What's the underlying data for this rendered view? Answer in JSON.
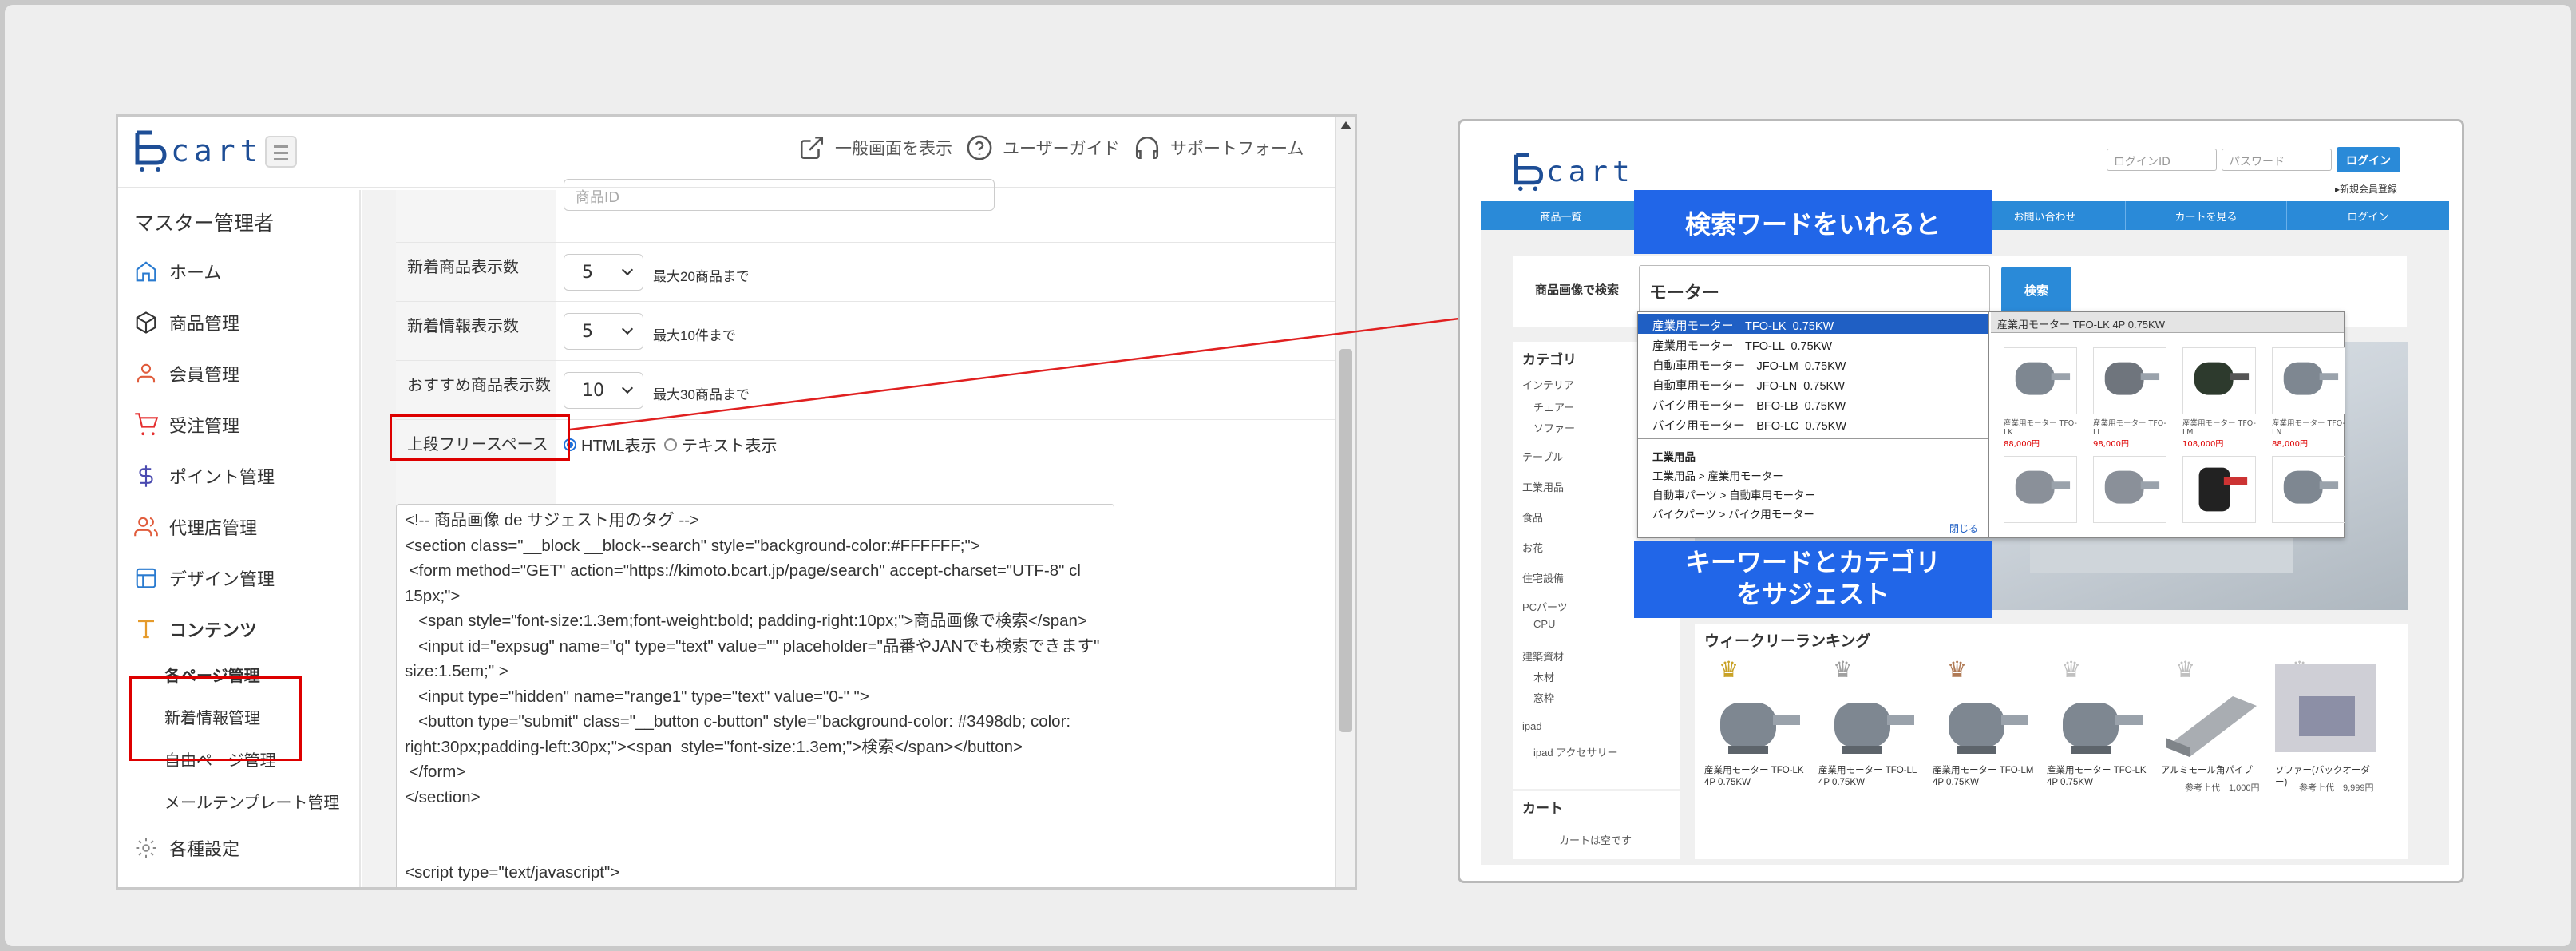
{
  "admin": {
    "logo_text": "cart",
    "header_links": [
      {
        "label": "一般画面を表示",
        "icon": "external-link-icon"
      },
      {
        "label": "ユーザーガイド",
        "icon": "help-circle-icon"
      },
      {
        "label": "サポートフォーム",
        "icon": "headset-icon"
      }
    ],
    "sidebar": {
      "title": "マスター管理者",
      "items": [
        {
          "label": "ホーム",
          "icon": "home-icon"
        },
        {
          "label": "商品管理",
          "icon": "box-icon"
        },
        {
          "label": "会員管理",
          "icon": "user-icon"
        },
        {
          "label": "受注管理",
          "icon": "cart-icon"
        },
        {
          "label": "ポイント管理",
          "icon": "dollar-icon"
        },
        {
          "label": "代理店管理",
          "icon": "users-icon"
        },
        {
          "label": "デザイン管理",
          "icon": "layout-icon"
        },
        {
          "label": "コンテンツ",
          "icon": "type-icon"
        }
      ],
      "sub_items": [
        "各ページ管理",
        "新着情報管理",
        "自由ページ管理",
        "メールテンプレート管理"
      ],
      "settings_label": "各種設定"
    },
    "form": {
      "product_id_placeholder": "商品ID",
      "rows": [
        {
          "label": "新着商品表示数",
          "value": "5",
          "note": "最大20商品まで"
        },
        {
          "label": "新着情報表示数",
          "value": "5",
          "note": "最大10件まで"
        },
        {
          "label": "おすすめ商品表示数",
          "value": "10",
          "note": "最大30商品まで"
        }
      ],
      "free_space_label": "上段フリースペース",
      "radio_html": "HTML表示",
      "radio_text": "テキスト表示",
      "code": "<!-- 商品画像 de サジェスト用のタグ -->\n<section class=\"__block __block--search\" style=\"background-color:#FFFFFF;\">\n <form method=\"GET\" action=\"https://kimoto.bcart.jp/page/search\" accept-charset=\"UTF-8\" cl\n15px;\">\n   <span style=\"font-size:1.3em;font-weight:bold; padding-right:10px;\">商品画像で検索</span>\n   <input id=\"expsug\" name=\"q\" type=\"text\" value=\"\" placeholder=\"品番やJANでも検索できます\"\nsize:1.5em;\" >\n   <input type=\"hidden\" name=\"range1\" type=\"text\" value=\"0-\" \">\n   <button type=\"submit\" class=\"__button c-button\" style=\"background-color: #3498db; color:\nright:30px;padding-left:30px;\"><span  style=\"font-size:1.3em;\">検索</span></button>\n </form>\n</section>\n\n\n<script type=\"text/javascript\">\n var elem = $('#expsug');"
    }
  },
  "store": {
    "logo_text": "cart",
    "login_id_placeholder": "ログインID",
    "password_placeholder": "パスワード",
    "login_button": "ログイン",
    "new_member": "▸新規会員登録",
    "gnav": [
      "商品一覧",
      "",
      "",
      "お問い合わせ",
      "カートを見る",
      "ログイン"
    ],
    "search_label": "商品画像で検索",
    "search_value": "モーター",
    "search_button": "検索",
    "categories_title": "カテゴリ",
    "categories": [
      "インテリア",
      "チェアー",
      "ソファー",
      "テーブル",
      "工業用品",
      "食品",
      "お花",
      "住宅設備",
      "PCパーツ",
      "CPU",
      "建築資材",
      "木材",
      "窓枠",
      "ipad",
      "ipad アクセサリー"
    ],
    "cart_title": "カート",
    "cart_empty": "カートは空です",
    "ranking_title": "ウィークリーランキング",
    "ranking": [
      {
        "name": "産業用モーター TFO-LK 4P 0.75KW",
        "price": ""
      },
      {
        "name": "産業用モーター TFO-LL 4P 0.75KW",
        "price": ""
      },
      {
        "name": "産業用モーター TFO-LM 4P 0.75KW",
        "price": ""
      },
      {
        "name": "産業用モーター TFO-LK 4P 0.75KW",
        "price": ""
      },
      {
        "name": "アルミモール角パイプ",
        "price": "参考上代　1,000円"
      },
      {
        "name": "ソファー(バックオーダー)",
        "price": "参考上代　9,999円"
      }
    ],
    "suggest": {
      "keywords": [
        "産業用モーター　TFO-LK  0.75KW",
        "産業用モーター　TFO-LL  0.75KW",
        "自動車用モーター　JFO-LM  0.75KW",
        "自動車用モーター　JFO-LN  0.75KW",
        "バイク用モーター　BFO-LB  0.75KW",
        "バイク用モーター　BFO-LC  0.75KW"
      ],
      "categories": [
        "工業用品",
        "工業用品 > 産業用モーター",
        "自動車パーツ > 自動車用モーター",
        "バイクパーツ > バイク用モーター"
      ],
      "close": "閉じる",
      "preview_title": "産業用モーター TFO-LK 4P 0.75KW",
      "products": [
        {
          "name": "産業用モーター TFO-LK",
          "price": "88,000円"
        },
        {
          "name": "産業用モーター TFO-LL",
          "price": "98,000円"
        },
        {
          "name": "産業用モーター TFO-LM",
          "price": "108,000円"
        },
        {
          "name": "産業用モーター TFO-LN",
          "price": "88,000円"
        }
      ]
    }
  },
  "callouts": {
    "search_word": "検索ワードをいれると",
    "suggest_line1": "キーワードとカテゴリ",
    "suggest_line2": "をサジェスト"
  },
  "colors": {
    "accent": "#2a8ad8",
    "callout": "#2166e8",
    "highlight": "#dd0000",
    "logo": "#1e4e96"
  }
}
